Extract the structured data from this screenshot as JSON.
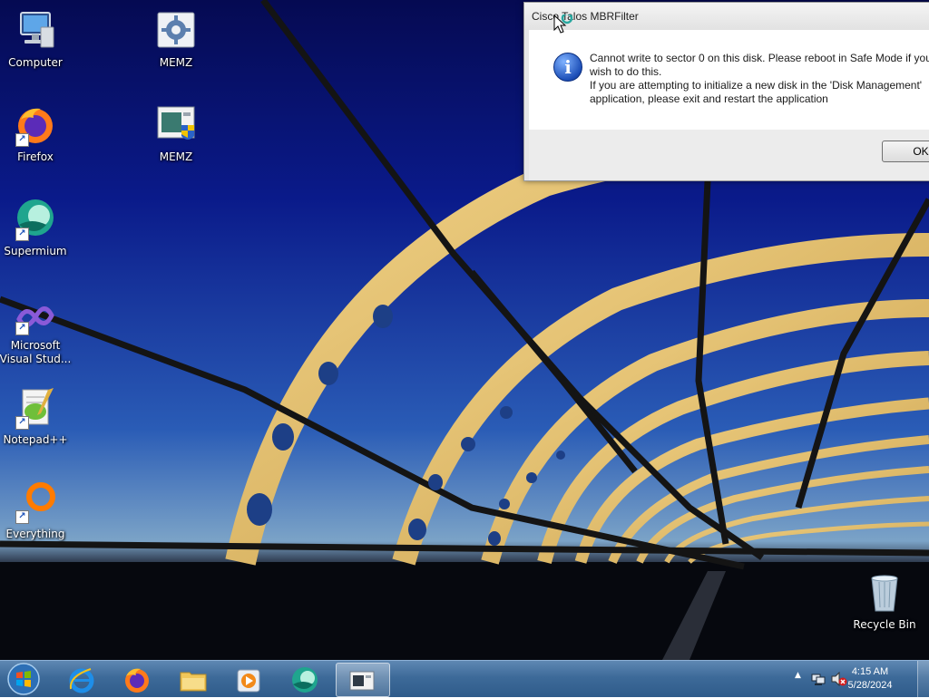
{
  "desktop": {
    "icons": [
      {
        "label": "Computer",
        "icon": "computer-icon",
        "shortcut": false
      },
      {
        "label": "Firefox",
        "icon": "firefox-icon",
        "shortcut": true
      },
      {
        "label": "Supermium",
        "icon": "supermium-icon",
        "shortcut": true
      },
      {
        "label": "Microsoft Visual Stud...",
        "icon": "visual-studio-icon",
        "shortcut": true
      },
      {
        "label": "Notepad++",
        "icon": "notepadpp-icon",
        "shortcut": true
      },
      {
        "label": "Everything",
        "icon": "everything-icon",
        "shortcut": true
      },
      {
        "label": "MEMZ",
        "icon": "memz-settings-icon",
        "shortcut": false
      },
      {
        "label": "MEMZ",
        "icon": "memz-app-icon",
        "shortcut": false
      },
      {
        "label": "Recycle Bin",
        "icon": "recycle-bin-icon",
        "shortcut": false
      }
    ]
  },
  "dialog": {
    "title": "Cisco Talos MBRFilter",
    "message_line1": "Cannot write to sector 0 on this disk. Please reboot in Safe Mode if you wish to do this.",
    "message_line2": "If you are attempting to initialize a new disk in the 'Disk Management' application, please exit and restart the application",
    "ok_label": "OK",
    "icon": "info-icon"
  },
  "taskbar": {
    "pinned": [
      "internet-explorer-icon",
      "firefox-icon",
      "file-explorer-icon",
      "media-player-icon",
      "supermium-icon",
      "mbrfilter-window-icon"
    ],
    "tray": {
      "time": "4:15 AM",
      "date": "5/28/2024",
      "icons": [
        "show-hidden-icons-icon",
        "network-icon",
        "volume-muted-icon"
      ]
    }
  },
  "colors": {
    "taskbar": "#3d6a99",
    "info_icon": "#1d4fb8",
    "dialog_bg": "#ffffff"
  }
}
